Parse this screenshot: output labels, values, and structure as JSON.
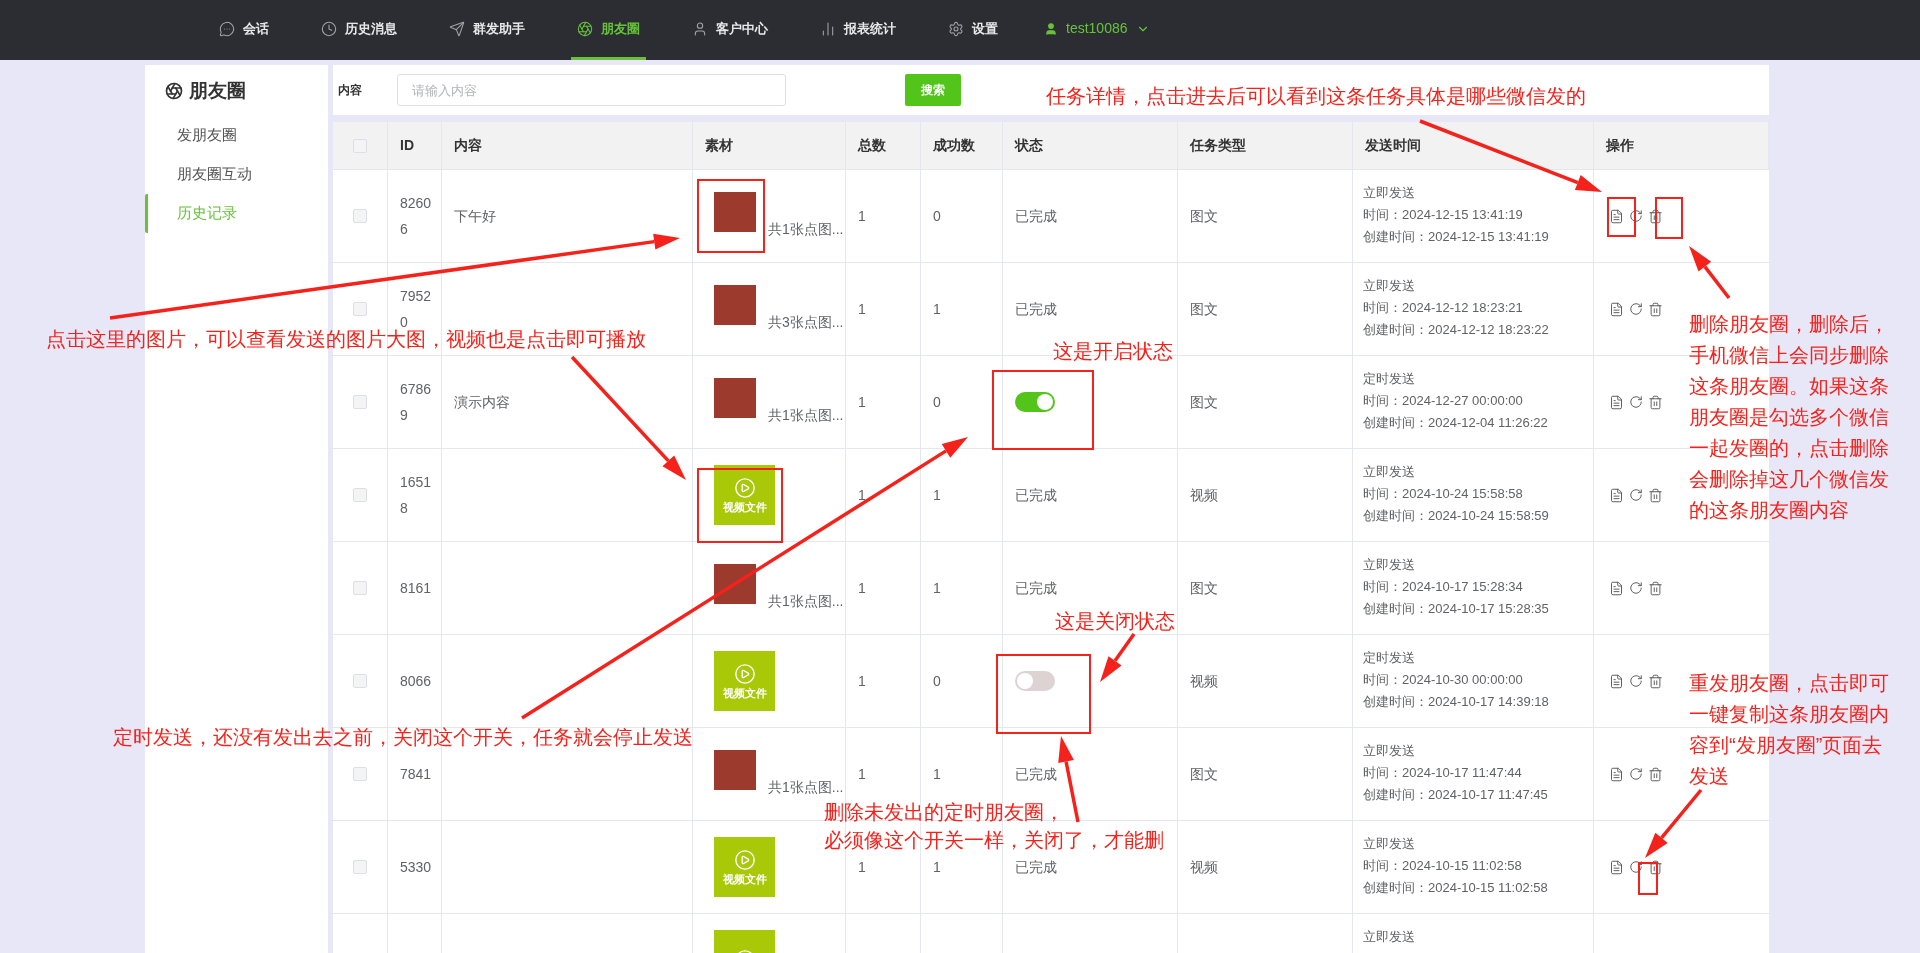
{
  "nav": {
    "items": [
      {
        "label": "会话",
        "selected": false
      },
      {
        "label": "历史消息",
        "selected": false
      },
      {
        "label": "群发助手",
        "selected": false
      },
      {
        "label": "朋友圈",
        "selected": true
      },
      {
        "label": "客户中心",
        "selected": false
      },
      {
        "label": "报表统计",
        "selected": false
      },
      {
        "label": "设置",
        "selected": false
      }
    ],
    "user": "test10086"
  },
  "sidebar": {
    "title": "朋友圈",
    "items": [
      {
        "label": "发朋友圈",
        "selected": false
      },
      {
        "label": "朋友圈互动",
        "selected": false
      },
      {
        "label": "历史记录",
        "selected": true
      }
    ]
  },
  "search": {
    "label": "内容",
    "placeholder": "请输入内容",
    "button": "搜索"
  },
  "table": {
    "header_checked": false,
    "columns": [
      "ID",
      "内容",
      "素材",
      "总数",
      "成功数",
      "状态",
      "任务类型",
      "发送时间",
      "操作"
    ],
    "rows": [
      {
        "checked": false,
        "id": "82606",
        "content": "下午好",
        "material": {
          "kind": "image",
          "caption": "共1张点图..."
        },
        "total": "1",
        "success": "0",
        "status": {
          "kind": "text",
          "text": "已完成"
        },
        "type": "图文",
        "send": {
          "mode": "立即发送",
          "time": "时间：2024-12-15 13:41:19",
          "created": "创建时间：2024-12-15 13:41:19"
        }
      },
      {
        "checked": false,
        "id": "79520",
        "material": {
          "kind": "image",
          "caption": "共3张点图..."
        },
        "total": "1",
        "success": "1",
        "status": {
          "kind": "text",
          "text": "已完成"
        },
        "type": "图文",
        "send": {
          "mode": "立即发送",
          "time": "时间：2024-12-12 18:23:21",
          "created": "创建时间：2024-12-12 18:23:22"
        }
      },
      {
        "checked": false,
        "id": "67869",
        "content": "演示内容",
        "material": {
          "kind": "image",
          "caption": "共1张点图..."
        },
        "total": "1",
        "success": "0",
        "status": {
          "kind": "toggle",
          "on": true
        },
        "type": "图文",
        "send": {
          "mode": "定时发送",
          "time": "时间：2024-12-27 00:00:00",
          "created": "创建时间：2024-12-04 11:26:22"
        }
      },
      {
        "checked": false,
        "id": "16518",
        "material": {
          "kind": "video",
          "label": "视频文件"
        },
        "total": "1",
        "success": "1",
        "status": {
          "kind": "text",
          "text": "已完成"
        },
        "type": "视频",
        "send": {
          "mode": "立即发送",
          "time": "时间：2024-10-24 15:58:58",
          "created": "创建时间：2024-10-24 15:58:59"
        }
      },
      {
        "checked": false,
        "id": "8161",
        "material": {
          "kind": "image",
          "caption": "共1张点图..."
        },
        "total": "1",
        "success": "1",
        "status": {
          "kind": "text",
          "text": "已完成"
        },
        "type": "图文",
        "send": {
          "mode": "立即发送",
          "time": "时间：2024-10-17 15:28:34",
          "created": "创建时间：2024-10-17 15:28:35"
        }
      },
      {
        "checked": false,
        "id": "8066",
        "material": {
          "kind": "video",
          "label": "视频文件"
        },
        "total": "1",
        "success": "0",
        "status": {
          "kind": "toggle",
          "on": false
        },
        "type": "视频",
        "send": {
          "mode": "定时发送",
          "time": "时间：2024-10-30 00:00:00",
          "created": "创建时间：2024-10-17 14:39:18"
        }
      },
      {
        "checked": false,
        "id": "7841",
        "material": {
          "kind": "image",
          "caption": "共1张点图..."
        },
        "total": "1",
        "success": "1",
        "status": {
          "kind": "text",
          "text": "已完成"
        },
        "type": "图文",
        "send": {
          "mode": "立即发送",
          "time": "时间：2024-10-17 11:47:44",
          "created": "创建时间：2024-10-17 11:47:45"
        }
      },
      {
        "checked": false,
        "id": "5330",
        "material": {
          "kind": "video",
          "label": "视频文件"
        },
        "total": "1",
        "success": "1",
        "status": {
          "kind": "text",
          "text": "已完成"
        },
        "type": "视频",
        "send": {
          "mode": "立即发送",
          "time": "时间：2024-10-15 11:02:58",
          "created": "创建时间：2024-10-15 11:02:58"
        }
      },
      {
        "material": {
          "kind": "video"
        },
        "send": {
          "mode": "立即发送"
        }
      }
    ]
  },
  "annotations": [
    "任务详情，点击进去后可以看到这条任务具体是哪些微信发的",
    "点击这里的图片，可以查看发送的图片大图，视频也是点击即可播放",
    "这是开启状态",
    "这是关闭状态",
    "定时发送，还没有发出去之前，关闭这个开关，任务就会停止发送",
    "删除未发出的定时朋友圈，",
    "必须像这个开关一样，关闭了，才能删",
    "删除朋友圈，删除后，手机微信上会同步删除这条朋友圈。如果这条朋友圈是勾选多个微信一起发圈的，点击删除会删除掉这几个微信发的这条朋友圈内容",
    "重发朋友圈，点击即可一键复制这条朋友圈内容到“发朋友圈”页面去发送"
  ]
}
